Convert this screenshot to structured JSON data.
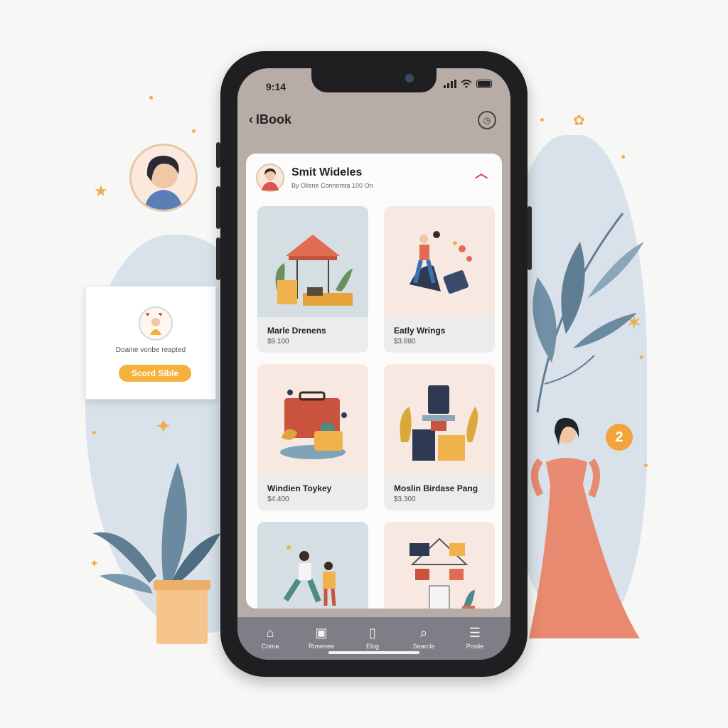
{
  "status_bar": {
    "time": "9:14"
  },
  "nav": {
    "back_label": "IBook",
    "right_icon": "clock-icon"
  },
  "profile": {
    "title": "Smit Wideles",
    "subtitle": "By Olisne Connomta 100 On"
  },
  "products": [
    {
      "name": "Marle Drenens",
      "price": "$9.100"
    },
    {
      "name": "Eatly Wrings",
      "price": "$3.880"
    },
    {
      "name": "Windien Toykey",
      "price": "$4.400"
    },
    {
      "name": "Moslin Birdase Pang",
      "price": "$3.300"
    },
    {
      "name": "",
      "price": ""
    },
    {
      "name": "",
      "price": ""
    }
  ],
  "tabs": [
    {
      "label": "Corna",
      "icon": "home-icon"
    },
    {
      "label": "Rimenee",
      "icon": "inbox-icon"
    },
    {
      "label": "Elog",
      "icon": "bag-icon"
    },
    {
      "label": "Searcle",
      "icon": "search-icon"
    },
    {
      "label": "Poslie",
      "icon": "menu-icon"
    }
  ],
  "promo": {
    "text": "Doaine vonbe reapted",
    "button": "Scord Sible"
  },
  "badge": {
    "count": "2"
  },
  "colors": {
    "accent": "#f5b13d",
    "screen_header": "#b7aca6",
    "tabbar": "#7e7e86",
    "chevron": "#d0473a"
  }
}
